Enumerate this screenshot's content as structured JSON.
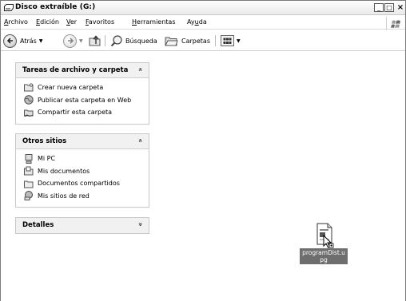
{
  "window": {
    "title": "Disco extraíble (G:)",
    "controls": {
      "minimize": "_",
      "maximize": "□",
      "close": "×"
    }
  },
  "menu": {
    "items": [
      {
        "label": "Archivo",
        "accel": "A",
        "rest": "rchivo"
      },
      {
        "label": "Edición",
        "accel": "E",
        "rest": "dición"
      },
      {
        "label": "Ver",
        "accel": "V",
        "rest": "er"
      },
      {
        "label": "Favoritos",
        "accel": "F",
        "rest": "avoritos"
      },
      {
        "label": "Herramientas",
        "accel": "H",
        "rest": "erramientas"
      },
      {
        "label": "Ayuda",
        "pre": "Ay",
        "accel": "u",
        "rest": "da"
      }
    ]
  },
  "toolbar": {
    "back_label": "Atrás",
    "search_label": "Búsqueda",
    "folders_label": "Carpetas"
  },
  "panels": {
    "tasks": {
      "title": "Tareas de archivo y carpeta",
      "chevron": "«",
      "items": [
        {
          "label": "Crear nueva carpeta",
          "icon": "new-folder-icon"
        },
        {
          "label": "Publicar esta carpeta en Web",
          "icon": "publish-web-icon"
        },
        {
          "label": "Compartir esta carpeta",
          "icon": "share-folder-icon"
        }
      ]
    },
    "places": {
      "title": "Otros sitios",
      "chevron": "«",
      "items": [
        {
          "label": "Mi PC",
          "icon": "my-computer-icon"
        },
        {
          "label": "Mis documentos",
          "icon": "my-documents-icon"
        },
        {
          "label": "Documentos compartidos",
          "icon": "shared-documents-icon"
        },
        {
          "label": "Mis sitios de red",
          "icon": "network-places-icon"
        }
      ]
    },
    "details": {
      "title": "Detalles",
      "chevron": "»"
    }
  },
  "files": [
    {
      "name": "programDist.upg",
      "icon": "file-icon",
      "selected": true
    }
  ]
}
